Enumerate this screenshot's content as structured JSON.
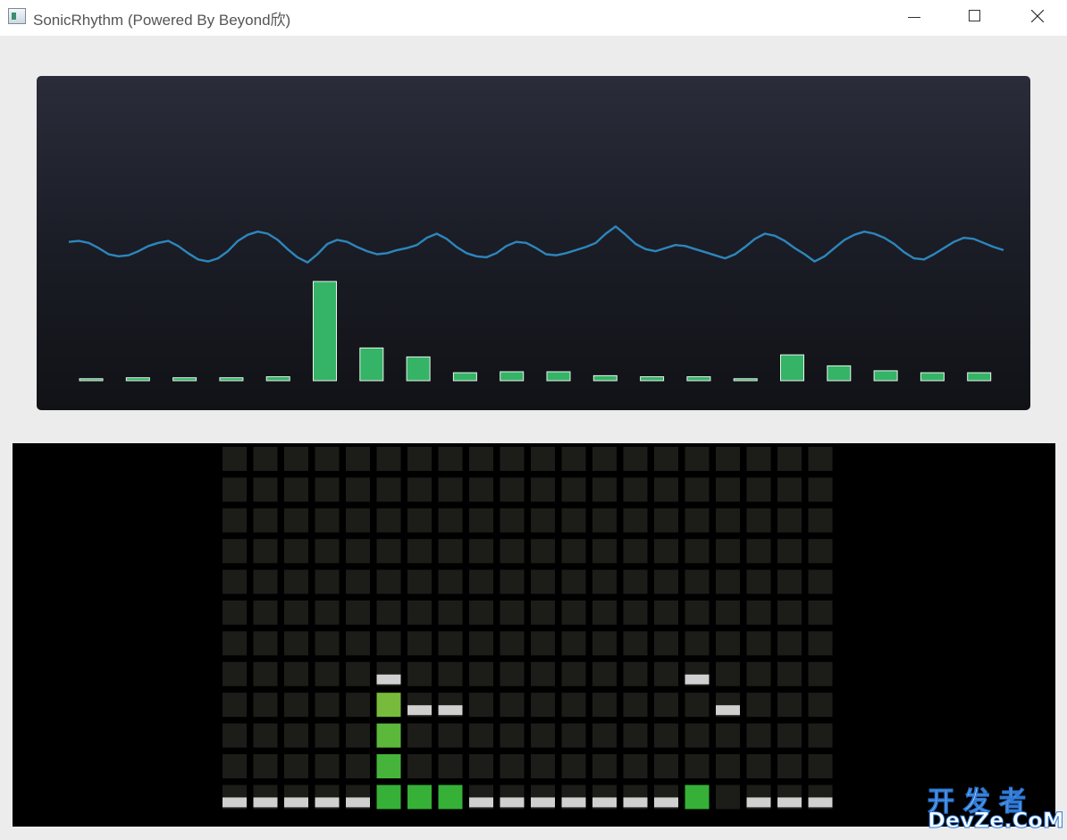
{
  "window": {
    "title": "SonicRhythm (Powered By Beyond欣)"
  },
  "colors": {
    "waveform": "#2d86bc",
    "spectrum_bar": "#35b366",
    "spectrum_outline": "#e8f5ec",
    "cell_off": "#1c1d18",
    "cell_peak": "#d0d0d0"
  },
  "spectrum": {
    "bar_levels": [
      0.02,
      0.03,
      0.03,
      0.03,
      0.04,
      1.0,
      0.33,
      0.24,
      0.08,
      0.09,
      0.09,
      0.05,
      0.04,
      0.04,
      0.02,
      0.26,
      0.15,
      0.1,
      0.08,
      0.08
    ]
  },
  "waveform": {
    "samples": [
      0.1,
      0.15,
      0.05,
      -0.2,
      -0.5,
      -0.6,
      -0.55,
      -0.35,
      -0.1,
      0.05,
      0.15,
      -0.1,
      -0.45,
      -0.75,
      -0.85,
      -0.7,
      -0.35,
      0.15,
      0.45,
      0.6,
      0.5,
      0.2,
      -0.25,
      -0.65,
      -0.9,
      -0.5,
      0,
      0.2,
      0.1,
      -0.15,
      -0.35,
      -0.5,
      -0.45,
      -0.3,
      -0.2,
      -0.05,
      0.3,
      0.5,
      0.25,
      -0.15,
      -0.45,
      -0.6,
      -0.65,
      -0.45,
      -0.1,
      0.1,
      0.05,
      -0.2,
      -0.5,
      -0.55,
      -0.45,
      -0.3,
      -0.15,
      0.05,
      0.5,
      0.85,
      0.45,
      0,
      -0.25,
      -0.35,
      -0.2,
      -0.05,
      -0.1,
      -0.25,
      -0.4,
      -0.55,
      -0.7,
      -0.5,
      -0.15,
      0.25,
      0.5,
      0.4,
      0.15,
      -0.2,
      -0.5,
      -0.85,
      -0.6,
      -0.2,
      0.2,
      0.45,
      0.6,
      0.5,
      0.3,
      0,
      -0.4,
      -0.7,
      -0.75,
      -0.5,
      -0.2,
      0.1,
      0.3,
      0.25,
      0.05,
      -0.15,
      -0.3
    ],
    "values_desc": "normalized amplitude -1..1"
  },
  "vu_grid": {
    "columns": 20,
    "rows": 12,
    "green_levels": [
      0,
      0,
      0,
      0,
      0,
      4,
      1,
      1,
      0,
      0,
      0,
      0,
      0,
      0,
      0,
      1,
      0,
      0,
      0,
      0
    ],
    "peak_rows": [
      1,
      1,
      1,
      1,
      1,
      5,
      4,
      4,
      1,
      1,
      1,
      1,
      1,
      1,
      1,
      5,
      4,
      1,
      1,
      1
    ],
    "green_palette": [
      "#36b037",
      "#46b43a",
      "#5cb83a",
      "#78bb3c"
    ]
  },
  "watermark": {
    "line1": "开发者",
    "line2": "DevZe.CoM"
  }
}
